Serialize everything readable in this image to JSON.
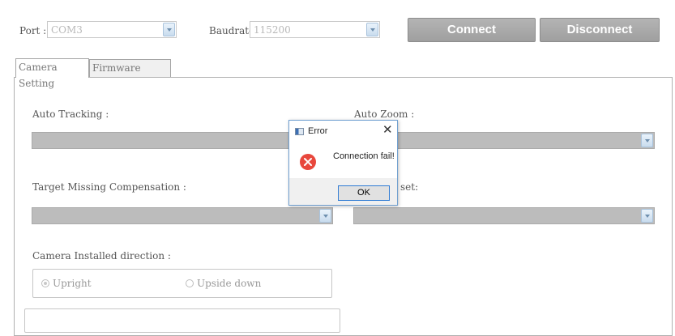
{
  "toolbar": {
    "port_label": "Port :",
    "port_value": "COM3",
    "baudrate_label": "Baudrate:",
    "baudrate_value": "115200",
    "connect_label": "Connect",
    "disconnect_label": "Disconnect"
  },
  "tabs": [
    {
      "label": "Camera Setting",
      "active": true
    },
    {
      "label": "Firmware Update",
      "active": false
    }
  ],
  "settings": {
    "auto_tracking_label": "Auto Tracking :",
    "auto_zoom_label": "Auto Zoom :",
    "target_missing_label": "Target Missing Compensation :",
    "partial_label_visible": "set:",
    "direction_label": "Camera Installed direction :",
    "direction_options": [
      "Upright",
      "Upside down"
    ],
    "direction_selected": "Upright"
  },
  "dialog": {
    "title": "Error",
    "message": "Connection fail!",
    "ok_label": "OK",
    "icon": "error-icon"
  },
  "colors": {
    "button_gray": "#a8a8a8",
    "disabled_combo": "#bcbcbc",
    "dialog_border": "#6f9fd0",
    "error_red": "#e8473c"
  }
}
